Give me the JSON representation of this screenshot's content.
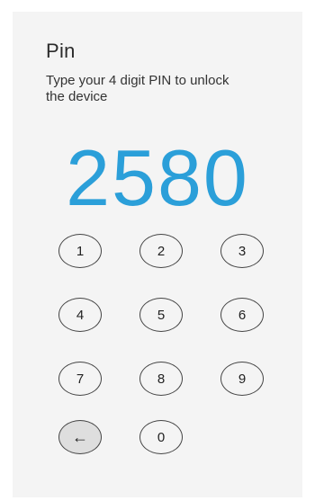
{
  "header": {
    "title": "Pin",
    "subtitle": "Type your 4 digit PIN to unlock the device"
  },
  "pin": {
    "value": "2580",
    "color": "#2b9fd9"
  },
  "keypad": {
    "key_1": "1",
    "key_2": "2",
    "key_3": "3",
    "key_4": "4",
    "key_5": "5",
    "key_6": "6",
    "key_7": "7",
    "key_8": "8",
    "key_9": "9",
    "key_0": "0",
    "backspace": "←",
    "backspace_icon": "backspace-arrow-icon"
  }
}
